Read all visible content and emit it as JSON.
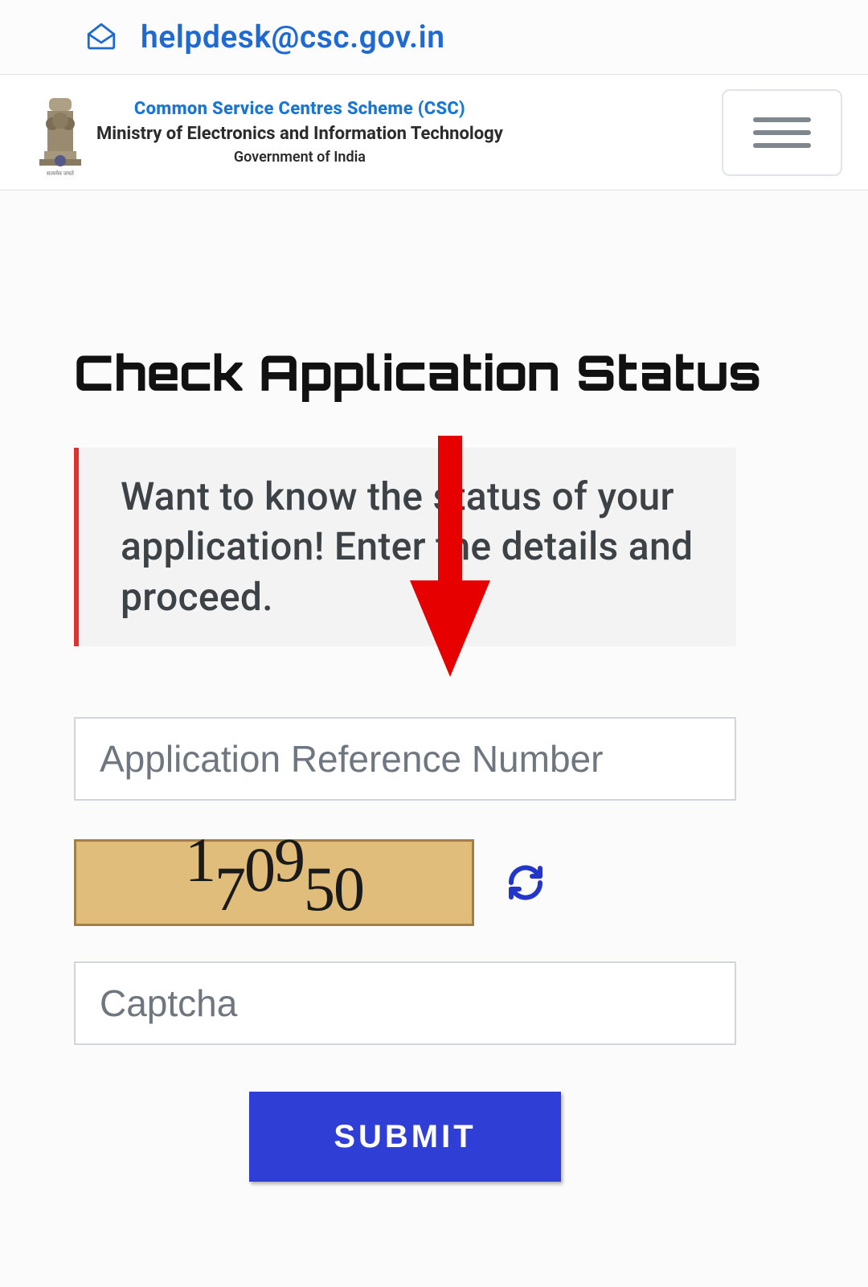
{
  "topbar": {
    "email": "helpdesk@csc.gov.in"
  },
  "header": {
    "line1": "Common Service Centres Scheme (CSC)",
    "line2": "Ministry of Electronics and Information Technology",
    "line3": "Government of India"
  },
  "main": {
    "title": "Check Application Status",
    "instruction": "Want to know the status of your application! Enter the details and proceed.",
    "ref_placeholder": "Application Reference Number",
    "captcha_value": "170950",
    "captcha_placeholder": "Captcha",
    "submit_label": "SUBMIT"
  }
}
